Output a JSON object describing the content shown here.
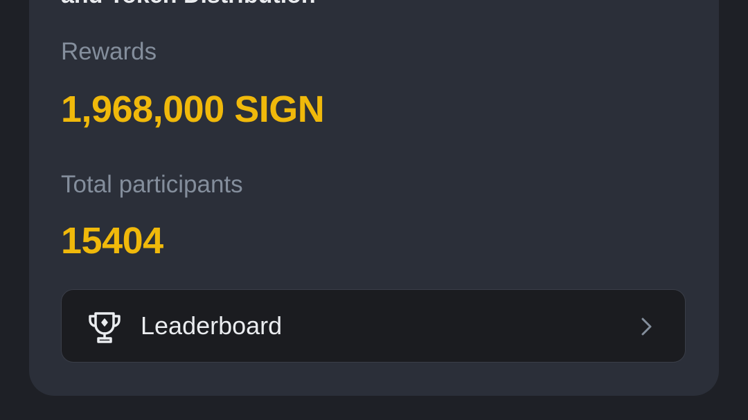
{
  "card": {
    "title": "and Token Distribution"
  },
  "rewards": {
    "label": "Rewards",
    "value": "1,968,000 SIGN"
  },
  "participants": {
    "label": "Total participants",
    "value": "15404"
  },
  "leaderboard": {
    "label": "Leaderboard",
    "icon": "trophy-icon",
    "chevron": "chevron-right-icon"
  },
  "colors": {
    "accent": "#f0b90b",
    "background": "#1e2026",
    "card": "#2b2f39",
    "muted_text": "#848e9c"
  }
}
